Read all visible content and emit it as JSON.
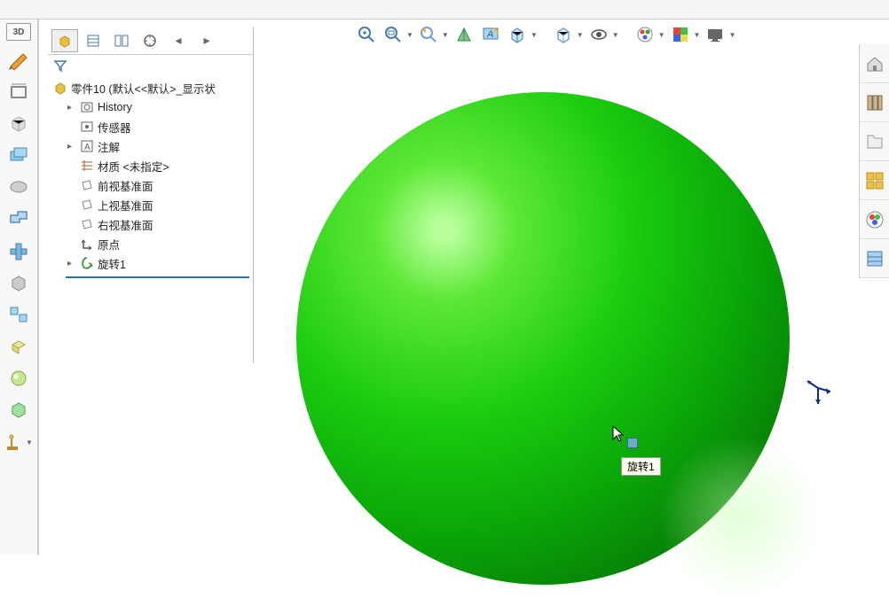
{
  "tree": {
    "root": "零件10  (默认<<默认>_显示状",
    "items": [
      {
        "icon": "history",
        "label": "History",
        "expandable": true
      },
      {
        "icon": "sensor",
        "label": "传感器"
      },
      {
        "icon": "annotation",
        "label": "注解",
        "expandable": true
      },
      {
        "icon": "material",
        "label": "材质 <未指定>"
      },
      {
        "icon": "plane",
        "label": "前视基准面"
      },
      {
        "icon": "plane",
        "label": "上视基准面"
      },
      {
        "icon": "plane",
        "label": "右视基准面"
      },
      {
        "icon": "origin",
        "label": "原点"
      },
      {
        "icon": "revolve",
        "label": "旋转1",
        "expandable": true
      }
    ]
  },
  "tooltip": "旋转1",
  "colors": {
    "sphere": "#1bcc0f",
    "triad": "#0a2a8a"
  }
}
